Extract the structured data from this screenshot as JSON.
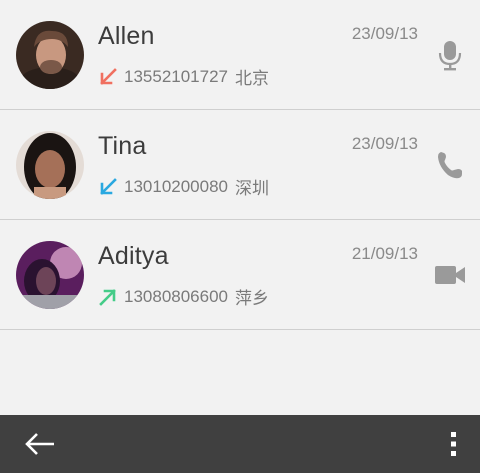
{
  "calls": [
    {
      "name": "Allen",
      "date": "23/09/13",
      "number": "13552101727",
      "location": "北京",
      "direction": "missed-incoming",
      "direction_color": "#f07060",
      "type": "voice-message",
      "avatar_colors": [
        "#3a2a22",
        "#c89880",
        "#6a4a3a"
      ]
    },
    {
      "name": "Tina",
      "date": "23/09/13",
      "number": "13010200080",
      "location": "深圳",
      "direction": "incoming",
      "direction_color": "#2aa8e0",
      "type": "phone",
      "avatar_colors": [
        "#1a1412",
        "#a57058",
        "#e4dcd6"
      ]
    },
    {
      "name": "Aditya",
      "date": "21/09/13",
      "number": "13080806600",
      "location": "萍乡",
      "direction": "outgoing",
      "direction_color": "#44cc88",
      "type": "video",
      "avatar_colors": [
        "#5a1e5e",
        "#d8a0c8",
        "#2a1230"
      ]
    }
  ],
  "colors": {
    "background": "#f2f2f2",
    "bottombar": "#404040",
    "icon_gray": "#9a9a9a"
  }
}
